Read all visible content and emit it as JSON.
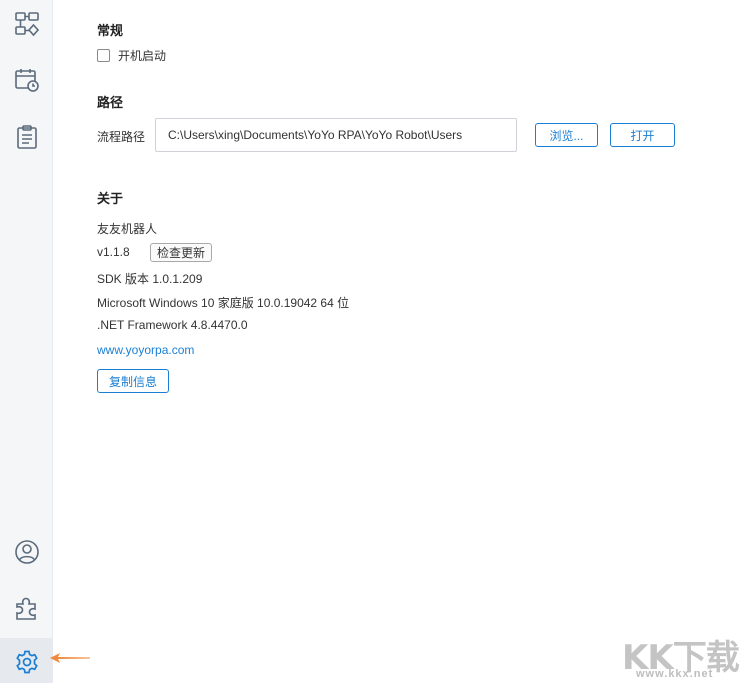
{
  "sidebar": {
    "items": [
      {
        "icon": "flowchart-icon"
      },
      {
        "icon": "calendar-clock-icon"
      },
      {
        "icon": "clipboard-icon"
      },
      {
        "icon": "user-icon"
      },
      {
        "icon": "puzzle-icon"
      },
      {
        "icon": "gear-icon",
        "active": true
      }
    ]
  },
  "general": {
    "title": "常规",
    "autostart_label": "开机启动",
    "autostart_checked": false
  },
  "path": {
    "title": "路径",
    "label": "流程路径",
    "value": "C:\\Users\\xing\\Documents\\YoYo RPA\\YoYo Robot\\Users",
    "browse_label": "浏览...",
    "open_label": "打开"
  },
  "about": {
    "title": "关于",
    "app_name": "友友机器人",
    "version": "v1.1.8",
    "check_update_label": "检查更新",
    "sdk_version": "SDK 版本 1.0.1.209",
    "os": "Microsoft Windows 10 家庭版 10.0.19042 64 位",
    "dotnet": ".NET Framework 4.8.4470.0",
    "website": "www.yoyorpa.com",
    "copy_label": "复制信息"
  },
  "watermark": {
    "text": "KK下载",
    "url": "www.kkx.net"
  },
  "colors": {
    "accent": "#1a7fd4",
    "icon": "#5b6b7b",
    "arrow": "#f08a3c"
  }
}
